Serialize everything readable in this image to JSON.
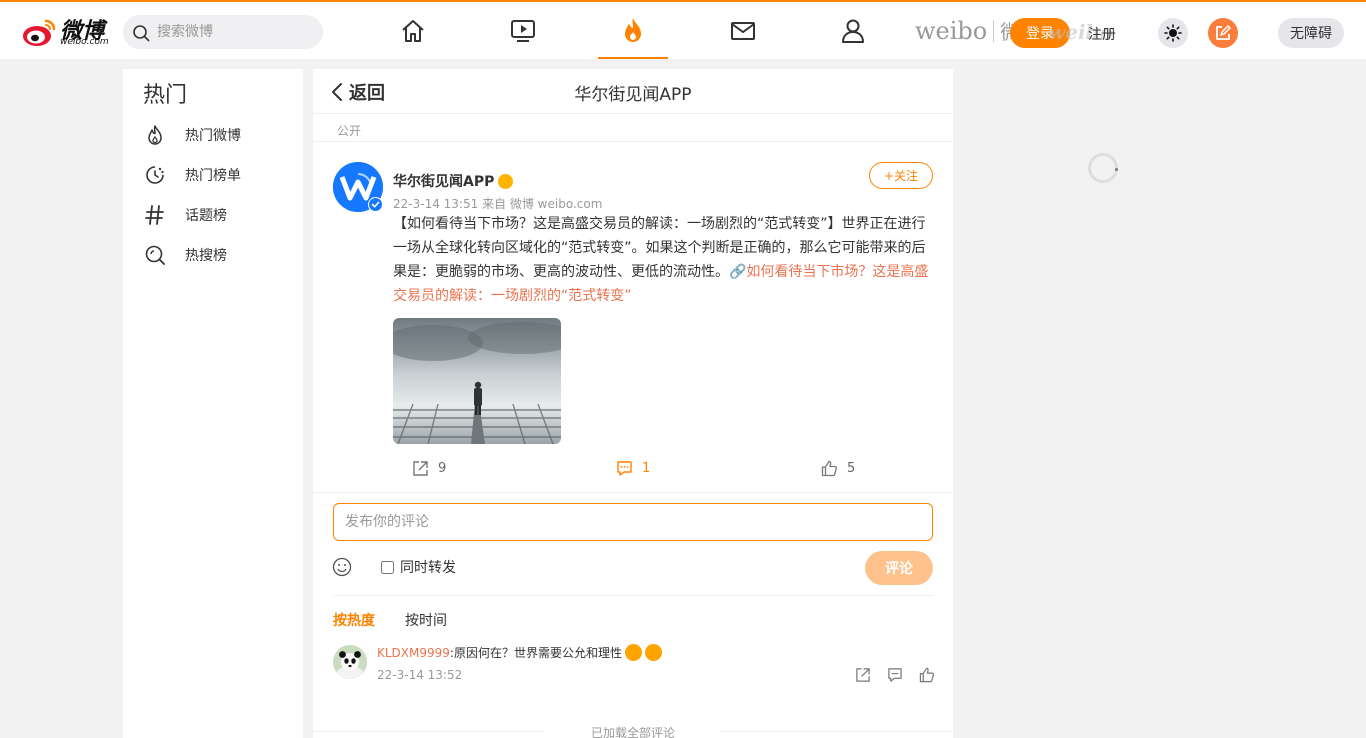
{
  "header": {
    "logo_text": "微博",
    "logo_sub": "weibo.com",
    "search_placeholder": "搜索微博",
    "watermark_en": "weibo",
    "watermark_cn": "微博",
    "login_label": "登录",
    "register_label": "注册",
    "accessibility_label": "无障碍",
    "nav_icons": [
      "home-icon",
      "video-icon",
      "hot-icon",
      "message-icon",
      "profile-icon"
    ]
  },
  "sidebar": {
    "title": "热门",
    "items": [
      {
        "label": "热门微博",
        "icon": "flame-icon"
      },
      {
        "label": "热门榜单",
        "icon": "clock-icon"
      },
      {
        "label": "话题榜",
        "icon": "hashtag-icon"
      },
      {
        "label": "热搜榜",
        "icon": "hot-search-icon"
      }
    ]
  },
  "main": {
    "back_label": "返回",
    "page_title": "华尔街见闻APP",
    "visibility": "公开",
    "post": {
      "author": "华尔街见闻APP",
      "meta": "22-3-14 13:51  来自 微博 weibo.com",
      "follow_label": "+关注",
      "text": "【如何看待当下市场？这是高盛交易员的解读：一场剧烈的“范式转变”】世界正在进行一场从全球化转向区域化的“范式转变”。如果这个判断是正确的，那么它可能带来的后果是：更脆弱的市场、更高的波动性、更低的流动性。",
      "link_text": "🔗如何看待当下市场？这是高盛交易员的解读：一场剧烈的“范式转变”",
      "repost_count": "9",
      "comment_count": "1",
      "like_count": "5"
    },
    "comment_box": {
      "placeholder": "发布你的评论",
      "repost_also": "同时转发",
      "submit_label": "评论"
    },
    "sort": {
      "by_hot": "按热度",
      "by_time": "按时间"
    },
    "comments": [
      {
        "user": "KLDXM9999",
        "text": ":原因何在？世界需要公允和理性",
        "time": "22-3-14 13:52"
      }
    ],
    "loaded_all": "已加载全部评论"
  },
  "colors": {
    "accent": "#ff8200",
    "link": "#eb7350",
    "verified": "#1677ff"
  }
}
